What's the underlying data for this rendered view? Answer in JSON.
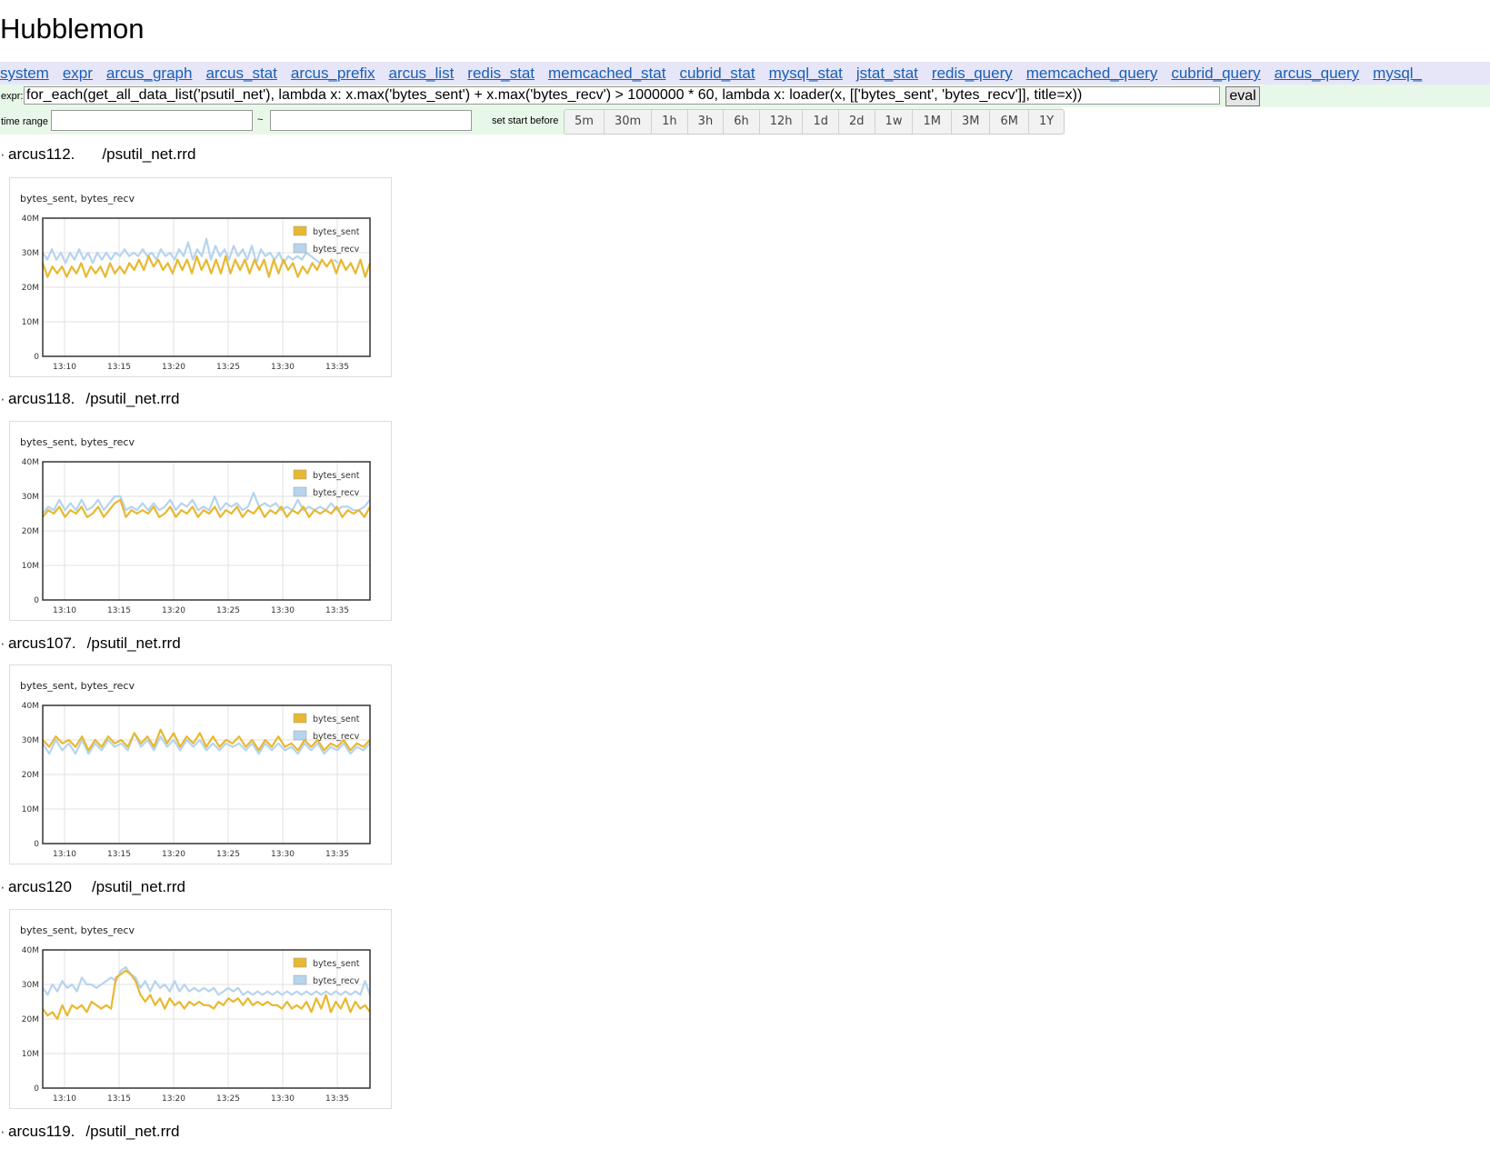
{
  "app_title": "Hubblemon",
  "nav_links": [
    "system",
    "expr",
    "arcus_graph",
    "arcus_stat",
    "arcus_prefix",
    "arcus_list",
    "redis_stat",
    "memcached_stat",
    "cubrid_stat",
    "mysql_stat",
    "jstat_stat",
    "redis_query",
    "memcached_query",
    "cubrid_query",
    "arcus_query",
    "mysql_"
  ],
  "expr": {
    "label": "expr:",
    "value": "for_each(get_all_data_list('psutil_net'), lambda x: x.max('bytes_sent') + x.max('bytes_recv') > 1000000 * 60, lambda x: loader(x, [['bytes_sent', 'bytes_recv']], title=x))",
    "button": "eval"
  },
  "time_range": {
    "label": "time range",
    "separator": "~",
    "start_value": "",
    "end_value": "",
    "set_start_label": "set start before",
    "buttons": [
      "5m",
      "30m",
      "1h",
      "3h",
      "6h",
      "12h",
      "1d",
      "2d",
      "1w",
      "1M",
      "3M",
      "6M",
      "1Y"
    ]
  },
  "colors": {
    "bytes_sent": "#e8b830",
    "bytes_recv": "#b6d4ee",
    "nav_bg": "#e6e6f8",
    "form_bg": "#e8f8e8",
    "link": "#1a5fb4"
  },
  "sections": [
    {
      "prefix": "arcus112.",
      "suffix": "/psutil_net.rrd"
    },
    {
      "prefix": "arcus118.",
      "suffix": "/psutil_net.rrd"
    },
    {
      "prefix": "arcus107.",
      "suffix": "/psutil_net.rrd"
    },
    {
      "prefix": "arcus120",
      "suffix": "/psutil_net.rrd"
    },
    {
      "prefix": "arcus119.",
      "suffix": "/psutil_net.rrd"
    }
  ],
  "chart_data": [
    {
      "type": "line",
      "title": "bytes_sent, bytes_recv",
      "yticks": [
        "40M",
        "30M",
        "20M",
        "10M",
        "0"
      ],
      "ylim": [
        0,
        40
      ],
      "y_unit": "M",
      "xticks": [
        "13:10",
        "13:15",
        "13:20",
        "13:25",
        "13:30",
        "13:35"
      ],
      "series": [
        {
          "name": "bytes_sent",
          "values": [
            27,
            23,
            26,
            24,
            26,
            23,
            26,
            24,
            27,
            23,
            26,
            24,
            26,
            23,
            27,
            24,
            26,
            24,
            27,
            25,
            28,
            25,
            29,
            26,
            28,
            25,
            27,
            24,
            28,
            25,
            28,
            24,
            29,
            25,
            28,
            24,
            28,
            24,
            29,
            24,
            28,
            25,
            28,
            24,
            28,
            25,
            28,
            23,
            28,
            24,
            28,
            25,
            27,
            23,
            26,
            24,
            27,
            25,
            28,
            26,
            28,
            24,
            28,
            25,
            27,
            24,
            28,
            23,
            27
          ]
        },
        {
          "name": "bytes_recv",
          "values": [
            30,
            28,
            31,
            28,
            30,
            27,
            30,
            28,
            31,
            28,
            30,
            27,
            30,
            28,
            30,
            28,
            30,
            29,
            31,
            29,
            30,
            29,
            31,
            29,
            30,
            28,
            31,
            29,
            30,
            28,
            31,
            29,
            33,
            28,
            31,
            29,
            34,
            28,
            32,
            29,
            31,
            28,
            32,
            29,
            31,
            28,
            32,
            27,
            31,
            29,
            30,
            28,
            30,
            27,
            29,
            28,
            29,
            28,
            30,
            29,
            28,
            27,
            null,
            null,
            28,
            27,
            null,
            null,
            null,
            null,
            null,
            null,
            31
          ]
        }
      ]
    },
    {
      "type": "line",
      "title": "bytes_sent, bytes_recv",
      "yticks": [
        "40M",
        "30M",
        "20M",
        "10M",
        "0"
      ],
      "ylim": [
        0,
        40
      ],
      "y_unit": "M",
      "xticks": [
        "13:10",
        "13:15",
        "13:20",
        "13:25",
        "13:30",
        "13:35"
      ],
      "series": [
        {
          "name": "bytes_sent",
          "values": [
            24,
            26,
            25,
            27,
            24,
            26,
            25,
            27,
            24,
            25,
            27,
            24,
            26,
            28,
            29,
            24,
            26,
            25,
            26,
            25,
            27,
            24,
            25,
            27,
            24,
            26,
            25,
            27,
            24,
            26,
            25,
            27,
            24,
            26,
            25,
            27,
            24,
            26,
            25,
            27,
            24,
            26,
            25,
            27,
            24,
            26,
            25,
            27,
            24,
            26,
            25,
            26,
            25,
            27,
            24,
            26,
            25,
            26,
            24,
            27
          ]
        },
        {
          "name": "bytes_recv",
          "values": [
            25,
            27,
            26,
            29,
            26,
            28,
            26,
            29,
            26,
            27,
            29,
            26,
            28,
            30,
            30,
            26,
            27,
            26,
            28,
            26,
            28,
            26,
            27,
            29,
            26,
            28,
            27,
            29,
            26,
            27,
            26,
            30,
            26,
            28,
            27,
            28,
            26,
            27,
            31,
            27,
            28,
            27,
            28,
            26,
            27,
            26,
            29,
            26,
            27,
            26,
            27,
            26,
            28,
            26,
            27,
            27,
            26,
            26,
            27,
            29
          ]
        }
      ]
    },
    {
      "type": "line",
      "title": "bytes_sent, bytes_recv",
      "yticks": [
        "40M",
        "30M",
        "20M",
        "10M",
        "0"
      ],
      "ylim": [
        0,
        40
      ],
      "y_unit": "M",
      "xticks": [
        "13:10",
        "13:15",
        "13:20",
        "13:25",
        "13:30",
        "13:35"
      ],
      "series": [
        {
          "name": "bytes_sent",
          "values": [
            30,
            28,
            31,
            29,
            30,
            28,
            31,
            27,
            30,
            28,
            31,
            29,
            30,
            28,
            32,
            29,
            31,
            28,
            33,
            29,
            32,
            28,
            31,
            29,
            32,
            28,
            31,
            28,
            30,
            29,
            31,
            28,
            30,
            27,
            30,
            28,
            31,
            28,
            29,
            27,
            30,
            28,
            30,
            27,
            29,
            28,
            30,
            27,
            29,
            28,
            30
          ]
        },
        {
          "name": "bytes_recv",
          "values": [
            29,
            26,
            30,
            27,
            29,
            26,
            30,
            26,
            29,
            27,
            30,
            28,
            29,
            27,
            32,
            28,
            30,
            27,
            31,
            28,
            30,
            27,
            30,
            28,
            30,
            27,
            29,
            27,
            29,
            28,
            29,
            27,
            29,
            26,
            29,
            27,
            29,
            27,
            28,
            26,
            29,
            27,
            29,
            26,
            28,
            27,
            29,
            26,
            28,
            27,
            29
          ]
        }
      ]
    },
    {
      "type": "line",
      "title": "bytes_sent, bytes_recv",
      "yticks": [
        "40M",
        "30M",
        "20M",
        "10M",
        "0"
      ],
      "ylim": [
        0,
        40
      ],
      "y_unit": "M",
      "xticks": [
        "13:10",
        "13:15",
        "13:20",
        "13:25",
        "13:30",
        "13:35"
      ],
      "series": [
        {
          "name": "bytes_sent",
          "values": [
            23,
            21,
            22,
            20,
            24,
            21,
            24,
            23,
            24,
            22,
            25,
            24,
            23,
            24,
            23,
            32,
            33,
            34,
            33,
            31,
            27,
            25,
            27,
            24,
            26,
            23,
            26,
            24,
            25,
            23,
            25,
            24,
            25,
            24,
            24,
            23,
            25,
            24,
            26,
            25,
            26,
            24,
            26,
            24,
            25,
            24,
            25,
            24,
            24,
            23,
            25,
            23,
            24,
            23,
            25,
            22,
            26,
            23,
            27,
            22,
            25,
            23,
            26,
            22,
            25,
            23,
            24,
            22
          ]
        },
        {
          "name": "bytes_recv",
          "values": [
            29,
            27,
            30,
            28,
            31,
            29,
            30,
            28,
            32,
            30,
            30,
            29,
            30,
            31,
            32,
            31,
            34,
            35,
            33,
            32,
            29,
            31,
            28,
            31,
            29,
            30,
            28,
            31,
            28,
            30,
            28,
            29,
            28,
            29,
            28,
            29,
            27,
            28,
            29,
            28,
            29,
            27,
            28,
            27,
            28,
            27,
            28,
            27,
            28,
            27,
            28,
            27,
            28,
            27,
            28,
            27,
            28,
            27,
            28,
            27,
            28,
            27,
            28,
            27,
            28,
            27,
            31,
            27
          ]
        }
      ]
    }
  ]
}
